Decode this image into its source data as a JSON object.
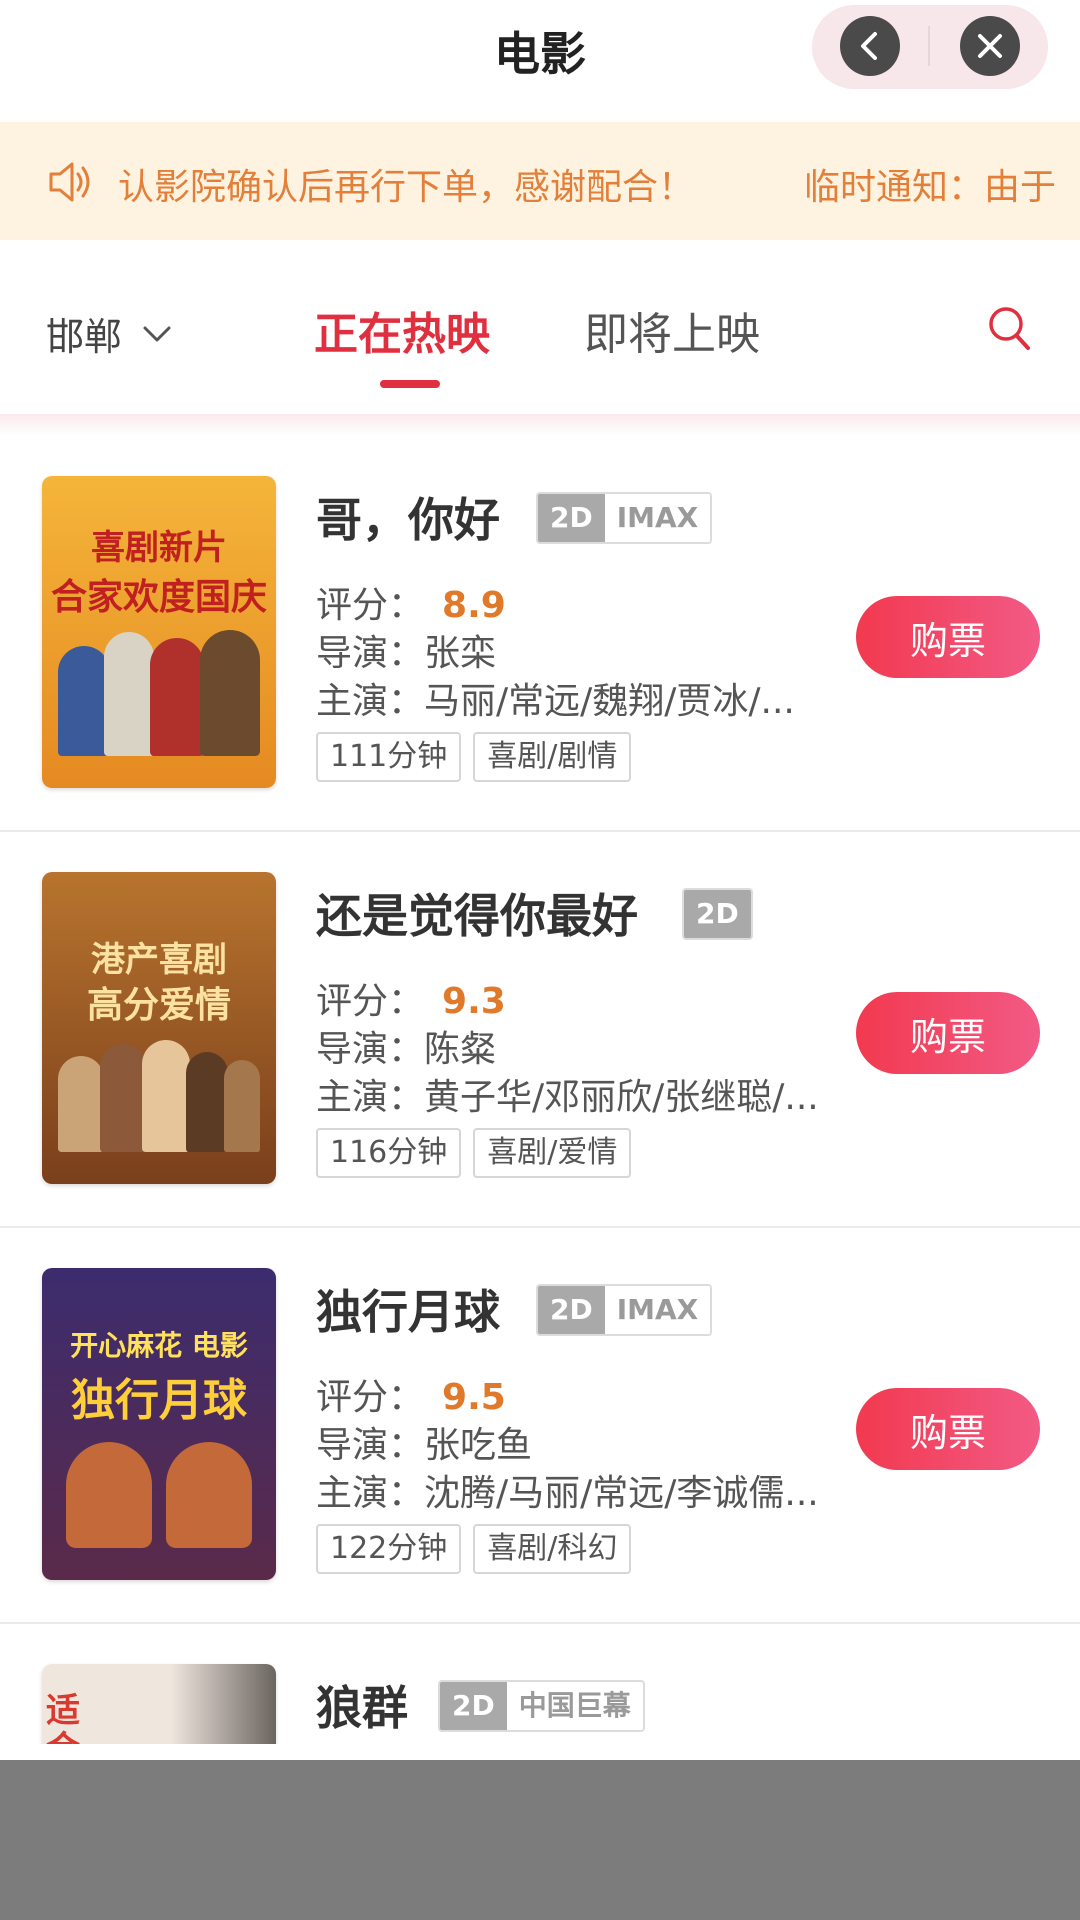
{
  "header": {
    "title": "电影"
  },
  "notice": {
    "segments": [
      "认影院确认后再行下单，感谢配合！",
      "临时通知：由于"
    ]
  },
  "filter": {
    "city": "邯郸",
    "tabs": [
      {
        "label": "正在热映",
        "active": true
      },
      {
        "label": "即将上映",
        "active": false
      }
    ]
  },
  "labels": {
    "score": "评分：",
    "director": "导演：",
    "cast": "主演：",
    "buy": "购票"
  },
  "movies": [
    {
      "title": "哥，你好",
      "format": "2D",
      "screen": "IMAX",
      "score": "8.9",
      "director": "张栾",
      "cast": "马丽/常远/魏翔/贾冰/...",
      "duration": "111分钟",
      "genre": "喜剧/剧情",
      "poster_lines": [
        "喜剧新片",
        "合家欢度国庆"
      ]
    },
    {
      "title": "还是觉得你最好",
      "format": "2D",
      "screen": "",
      "score": "9.3",
      "director": "陈粲",
      "cast": "黄子华/邓丽欣/张继聪/...",
      "duration": "116分钟",
      "genre": "喜剧/爱情",
      "poster_lines": [
        "港产喜剧",
        "高分爱情"
      ]
    },
    {
      "title": "独行月球",
      "format": "2D",
      "screen": "IMAX",
      "score": "9.5",
      "director": "张吃鱼",
      "cast": "沈腾/马丽/常远/李诚儒...",
      "duration": "122分钟",
      "genre": "喜剧/科幻",
      "poster_lines": [
        "开心麻花 电影",
        "独行月球"
      ]
    },
    {
      "title": "狼群",
      "format": "2D",
      "screen": "中国巨幕",
      "score": "",
      "director": "",
      "cast": "",
      "duration": "",
      "genre": "",
      "poster_lines": [
        "适合看",
        ""
      ]
    }
  ],
  "colors": {
    "accent": "#e0303f",
    "score": "#e07a2a",
    "notice_bg": "#fdf3e0",
    "notice_text": "#e37f38"
  }
}
